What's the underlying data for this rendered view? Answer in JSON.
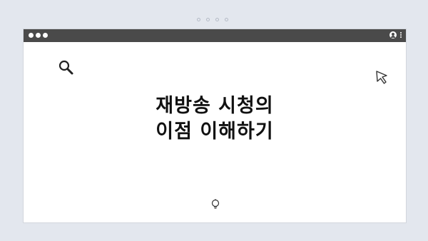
{
  "content": {
    "headline_line1": "재방송 시청의",
    "headline_line2": "이점 이해하기"
  },
  "icons": {
    "outer_dots": [
      "dot",
      "dot",
      "dot",
      "dot"
    ],
    "title_controls": [
      "dot",
      "dot",
      "dot"
    ],
    "user": "user-icon",
    "menu": "kebab-menu-icon",
    "search": "search-icon",
    "cursor": "cursor-icon",
    "bulb": "lightbulb-icon"
  },
  "colors": {
    "background": "#e3e7ee",
    "titlebar": "#4a4a4a",
    "text": "#111111"
  }
}
